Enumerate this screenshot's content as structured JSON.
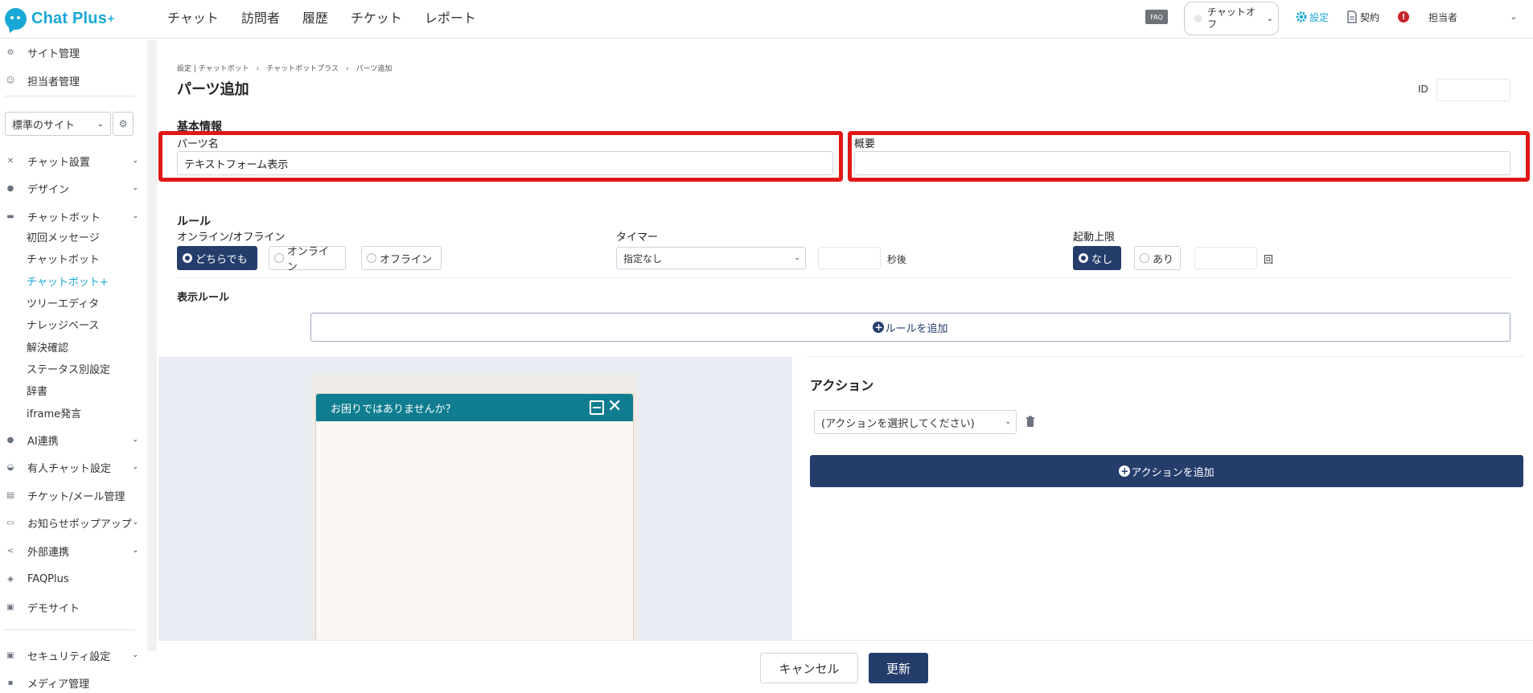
{
  "app": {
    "logo_text": "Chat Plus",
    "logo_sup": "+",
    "brand_color": "#17a8d6",
    "accent_color": "#253d6b",
    "highlight_color": "#e01818"
  },
  "topnav": [
    "チャット",
    "訪問者",
    "履歴",
    "チケット",
    "レポート"
  ],
  "topbar": {
    "faq": "FAQ",
    "chat_status": "チャットオフ",
    "settings": "設定",
    "contract": "契約",
    "alert": "!",
    "user": "担当者"
  },
  "sidebar": {
    "top_items": [
      "サイト管理",
      "担当者管理"
    ],
    "site_select": "標準のサイト",
    "menu": [
      {
        "label": "チャット設置",
        "icon": "wrench-icon",
        "has_chevron": true
      },
      {
        "label": "デザイン",
        "icon": "palette-icon",
        "has_chevron": true
      },
      {
        "label": "チャットボット",
        "icon": "chat-icon",
        "has_chevron": true
      }
    ],
    "chatbot_subitems": [
      "初回メッセージ",
      "チャットボット",
      "チャットボット+",
      "ツリーエディタ",
      "ナレッジベース",
      "解決確認",
      "ステータス別設定",
      "辞書",
      "iframe発言"
    ],
    "active_subitem": "チャットボット+",
    "bottom_menu": [
      {
        "label": "AI連携",
        "icon": "ai-icon",
        "has_chevron": true
      },
      {
        "label": "有人チャット設定",
        "icon": "headset-icon",
        "has_chevron": true
      },
      {
        "label": "チケット/メール管理",
        "icon": "ticket-icon",
        "has_chevron": false
      },
      {
        "label": "お知らせポップアップ",
        "icon": "popup-icon",
        "has_chevron": true
      },
      {
        "label": "外部連携",
        "icon": "share-icon",
        "has_chevron": true
      },
      {
        "label": "FAQPlus",
        "icon": "shield-icon",
        "has_chevron": false
      },
      {
        "label": "デモサイト",
        "icon": "window-icon",
        "has_chevron": false
      }
    ],
    "footer_menu": [
      {
        "label": "セキュリティ設定",
        "icon": "lock-icon",
        "has_chevron": true
      },
      {
        "label": "メディア管理",
        "icon": "media-icon",
        "has_chevron": false
      }
    ]
  },
  "main": {
    "breadcrumb": "設定 | チャットボット　›　チャットボットプラス　›　パーツ追加",
    "title": "パーツ追加",
    "id_label": "ID",
    "id_value": "",
    "basic_info": {
      "heading": "基本情報",
      "parts_name_label": "パーツ名",
      "parts_name_value": "テキストフォーム表示",
      "summary_label": "概要",
      "summary_value": ""
    },
    "rules": {
      "heading": "ルール",
      "online_label": "オンライン/オフライン",
      "online_options": [
        "どちらでも",
        "オンライン",
        "オフライン"
      ],
      "online_selected": "どちらでも",
      "timer_label": "タイマー",
      "timer_value": "指定なし",
      "timer_unit": "秒後",
      "limit_label": "起動上限",
      "limit_options": [
        "なし",
        "あり"
      ],
      "limit_selected": "なし",
      "limit_unit": "回",
      "display_rule_heading": "表示ルール",
      "add_rule": "ルールを追加"
    },
    "preview": {
      "chat_header": "お困りではありませんか？"
    },
    "action": {
      "heading": "アクション",
      "select_value": "(アクションを選択してください)",
      "add_action": "アクションを追加"
    },
    "footer": {
      "cancel": "キャンセル",
      "update": "更新"
    }
  }
}
